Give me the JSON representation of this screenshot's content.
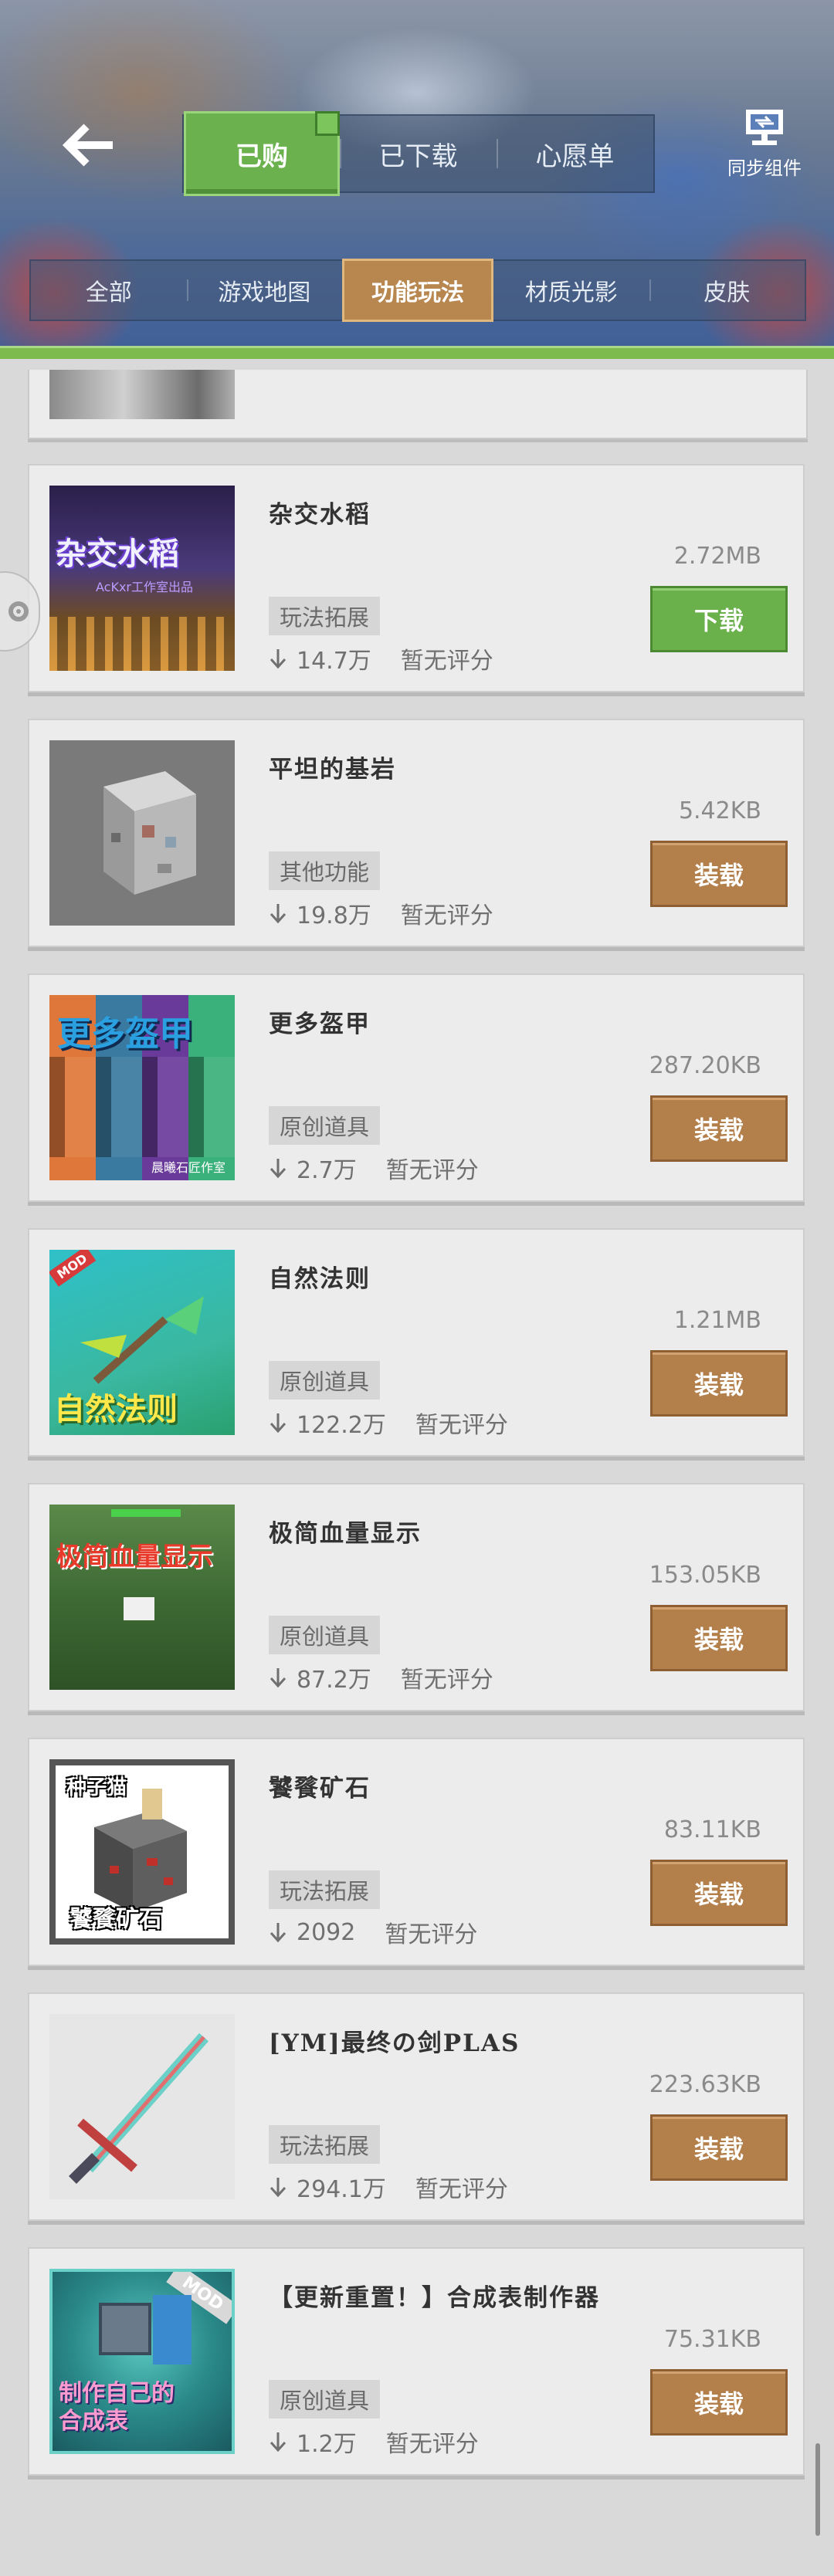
{
  "header": {
    "top_tabs": [
      {
        "label": "已购",
        "active": true
      },
      {
        "label": "已下载",
        "active": false
      },
      {
        "label": "心愿单",
        "active": false
      }
    ],
    "sync_label": "同步组件",
    "categories": [
      {
        "label": "全部",
        "active": false
      },
      {
        "label": "游戏地图",
        "active": false
      },
      {
        "label": "功能玩法",
        "active": true
      },
      {
        "label": "材质光影",
        "active": false
      },
      {
        "label": "皮肤",
        "active": false
      }
    ]
  },
  "items": [
    {
      "title": "杂交水稻",
      "size": "2.72MB",
      "tag": "玩法拓展",
      "downloads": "14.7万",
      "rating": "暂无评分",
      "button": "下载",
      "button_type": "download",
      "thumb_text": "杂交水稻",
      "thumb_sub": "AcKxr工作室出品"
    },
    {
      "title": "平坦的基岩",
      "size": "5.42KB",
      "tag": "其他功能",
      "downloads": "19.8万",
      "rating": "暂无评分",
      "button": "装载",
      "button_type": "install"
    },
    {
      "title": "更多盔甲",
      "size": "287.20KB",
      "tag": "原创道具",
      "downloads": "2.7万",
      "rating": "暂无评分",
      "button": "装载",
      "button_type": "install",
      "thumb_text": "更多盔甲",
      "thumb_sub": "晨曦石匠作室"
    },
    {
      "title": "自然法则",
      "size": "1.21MB",
      "tag": "原创道具",
      "downloads": "122.2万",
      "rating": "暂无评分",
      "button": "装载",
      "button_type": "install",
      "thumb_text": "自然法则",
      "thumb_badge": "MOD"
    },
    {
      "title": "极简血量显示",
      "size": "153.05KB",
      "tag": "原创道具",
      "downloads": "87.2万",
      "rating": "暂无评分",
      "button": "装载",
      "button_type": "install",
      "thumb_text": "极简血量显示"
    },
    {
      "title": "饕餮矿石",
      "size": "83.11KB",
      "tag": "玩法拓展",
      "downloads": "2092",
      "rating": "暂无评分",
      "button": "装载",
      "button_type": "install",
      "thumb_text": "饕餮矿石",
      "thumb_sub": "种子猫"
    },
    {
      "title": "[YM]最终の剑PLAS",
      "size": "223.63KB",
      "tag": "玩法拓展",
      "downloads": "294.1万",
      "rating": "暂无评分",
      "button": "装载",
      "button_type": "install"
    },
    {
      "title": "【更新重置！】合成表制作器",
      "size": "75.31KB",
      "tag": "原创道具",
      "downloads": "1.2万",
      "rating": "暂无评分",
      "button": "装载",
      "button_type": "install",
      "thumb_text": "制作自己的合成表",
      "thumb_badge": "MOD"
    }
  ],
  "colors": {
    "install_button": "#b3804c",
    "download_button": "#6ab04b",
    "active_top_tab": "#6bb24e",
    "active_category": "#b8874f"
  }
}
